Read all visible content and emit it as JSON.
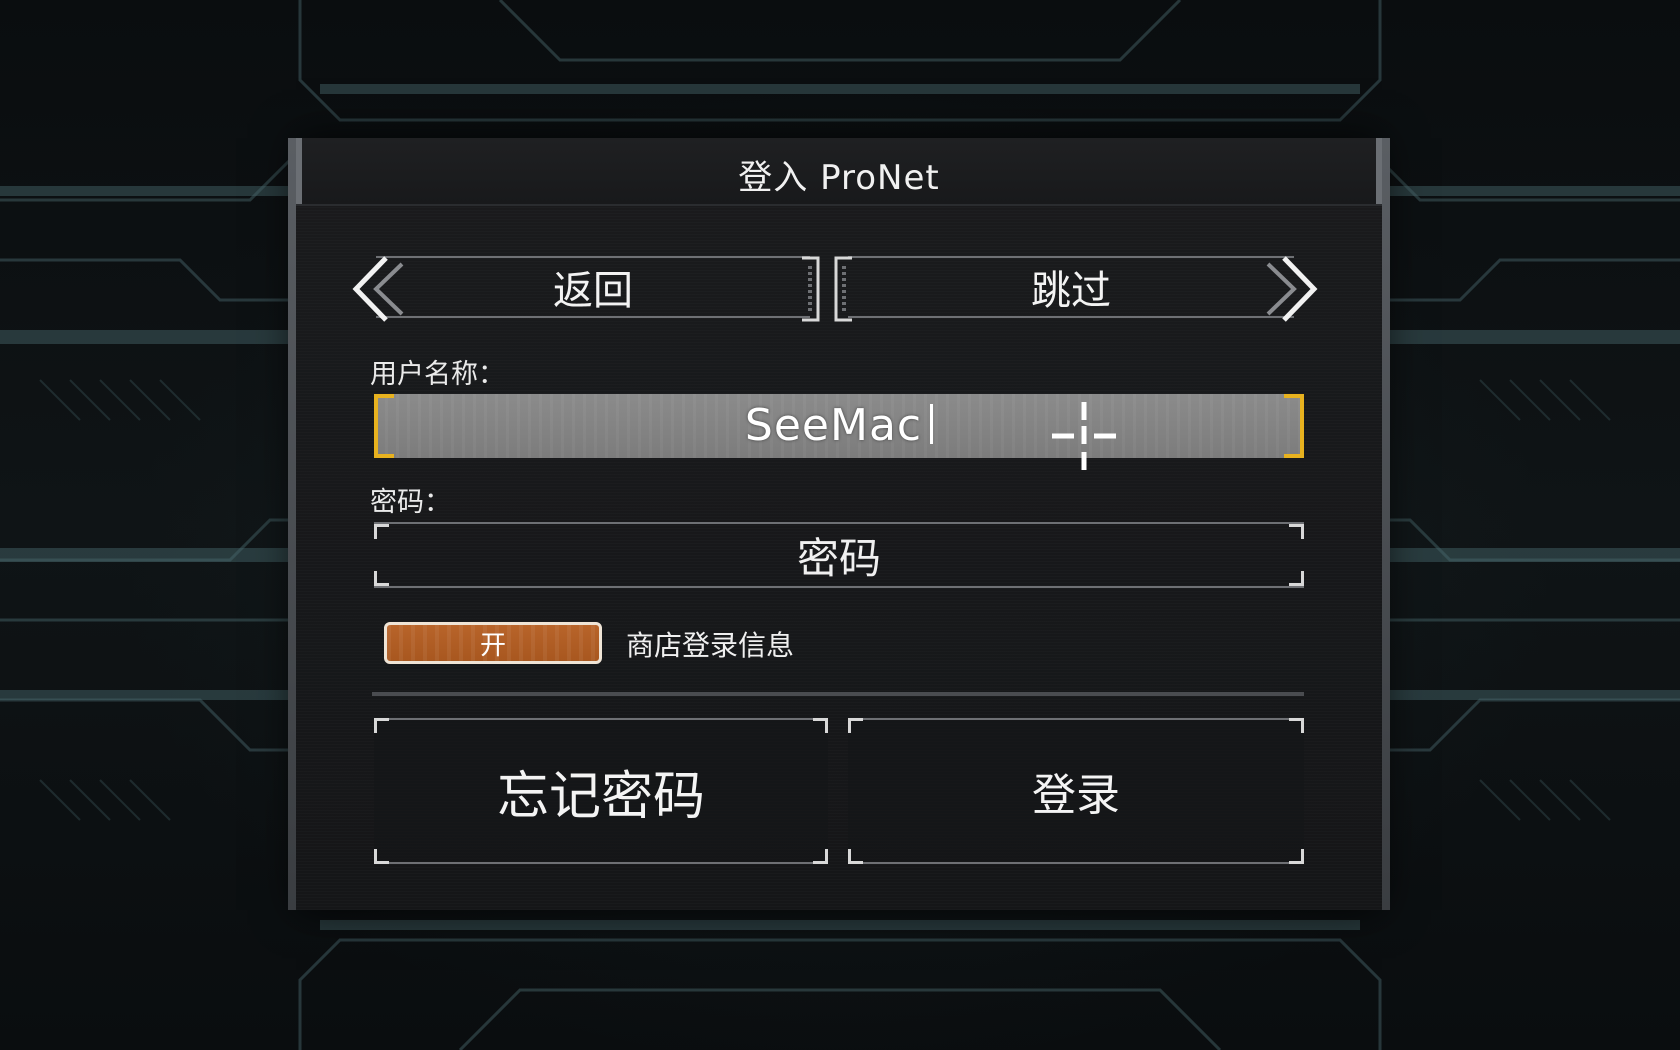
{
  "dialog": {
    "title": "登入 ProNet"
  },
  "nav": {
    "back_label": "返回",
    "skip_label": "跳过"
  },
  "username": {
    "label": "用户名称：",
    "value": "SeeMac"
  },
  "password": {
    "label": "密码：",
    "placeholder": "密码"
  },
  "store_login": {
    "toggle_state": "开",
    "label": "商店登录信息"
  },
  "actions": {
    "forgot_label": "忘记密码",
    "login_label": "登录"
  },
  "icons": {
    "back_arrow": "double-chevron-left-icon",
    "skip_arrow": "double-chevron-right-icon",
    "cursor": "crosshair-icon"
  },
  "colors": {
    "field_highlight": "#e8b21f",
    "toggle_on": "#b8642a",
    "background": "#0b0e10",
    "panel": "#18191b"
  }
}
